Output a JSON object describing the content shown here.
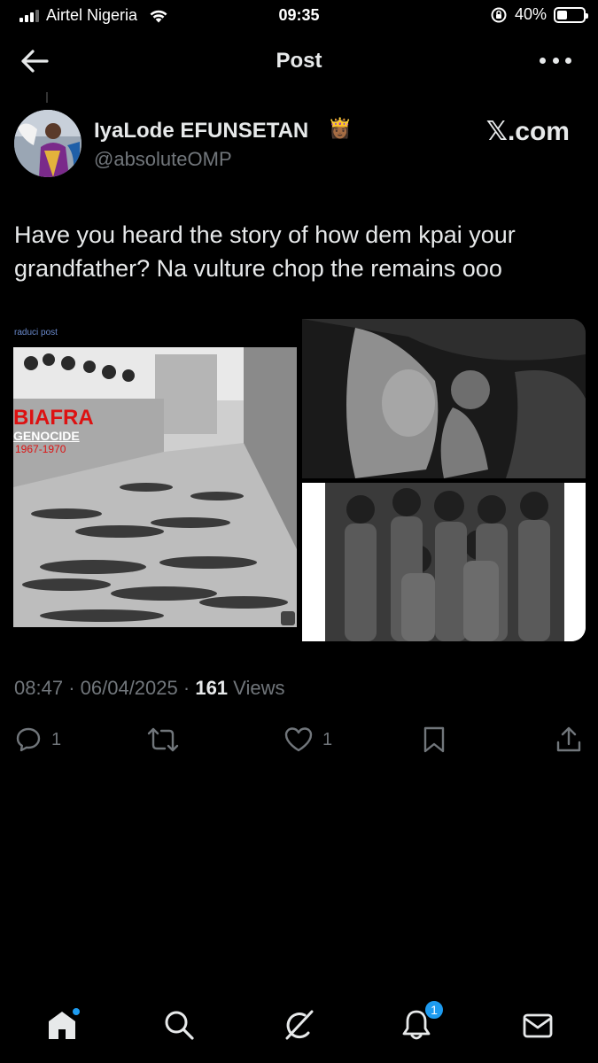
{
  "status_bar": {
    "carrier": "Airtel Nigeria",
    "time": "09:35",
    "battery_percent": "40%",
    "battery_level": 0.4,
    "signal_bars": 3
  },
  "nav": {
    "title": "Post",
    "icons": {
      "back": "arrow-left-icon",
      "more": "more-horizontal-icon"
    }
  },
  "author": {
    "name": "IyaLode EFUNSETAN",
    "emoji": "👸🏾",
    "handle": "@absoluteOMP",
    "source_mark": "𝕏.com"
  },
  "tweet": {
    "text": "Have you heard the story of how dem kpai your grandfather? Na vulture chop the remains ooo"
  },
  "media": {
    "left_image": {
      "source_label": "raduci post",
      "title": "BIAFRA",
      "subtitle": "GENOCIDE",
      "years": "1967-1970"
    }
  },
  "meta": {
    "time": "08:47",
    "separator": "·",
    "date": "06/04/2025",
    "views_count": "161",
    "views_label": "Views"
  },
  "actions": {
    "reply_count": "1",
    "repost_count": "",
    "like_count": "1",
    "icons": [
      "reply-icon",
      "repost-icon",
      "like-icon",
      "bookmark-icon",
      "share-icon"
    ]
  },
  "tabbar": {
    "icons": [
      "home-icon",
      "search-icon",
      "grok-icon",
      "notifications-icon",
      "messages-icon"
    ],
    "notifications_badge": "1",
    "accent": "#1d9bf0"
  },
  "colors": {
    "background": "#000000",
    "text_primary": "#e7e9ea",
    "text_secondary": "#71767b",
    "accent": "#1d9bf0"
  }
}
